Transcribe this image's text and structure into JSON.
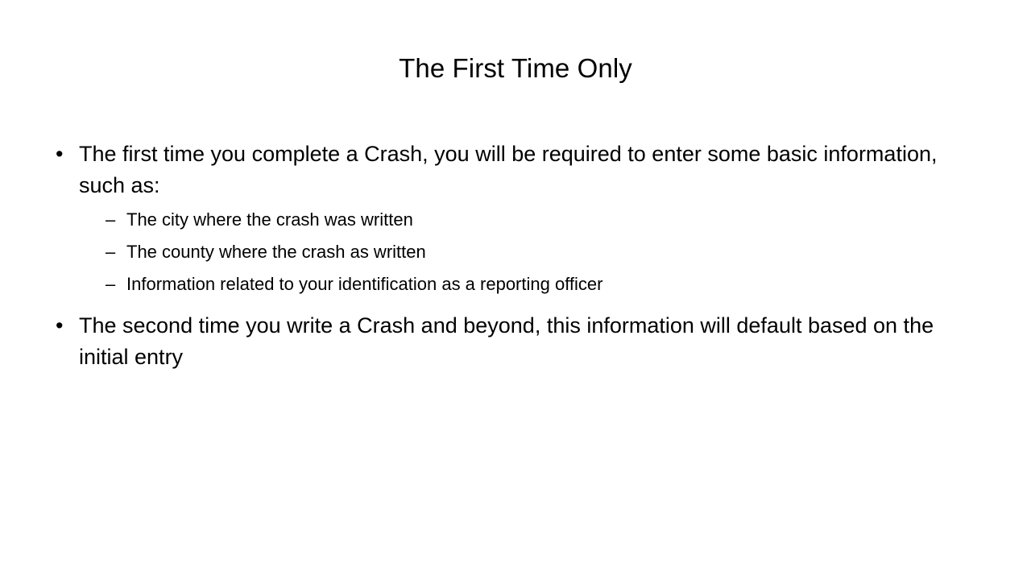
{
  "slide": {
    "title": "The First Time Only",
    "background_color": "#ffffff",
    "text_color": "#000000",
    "bullet_marker_level1": "•",
    "bullet_marker_level2": "–",
    "bullets": [
      {
        "level": 1,
        "text": "The first time you complete a Crash, you will be required to enter some basic information, such as:",
        "children": [
          {
            "level": 2,
            "text": "The city where the crash was written"
          },
          {
            "level": 2,
            "text": "The county where the crash as written"
          },
          {
            "level": 2,
            "text": "Information related to your identification as a reporting officer"
          }
        ]
      },
      {
        "level": 1,
        "text": "The second time you write a Crash and beyond, this information will default based on the initial entry",
        "children": []
      }
    ]
  }
}
